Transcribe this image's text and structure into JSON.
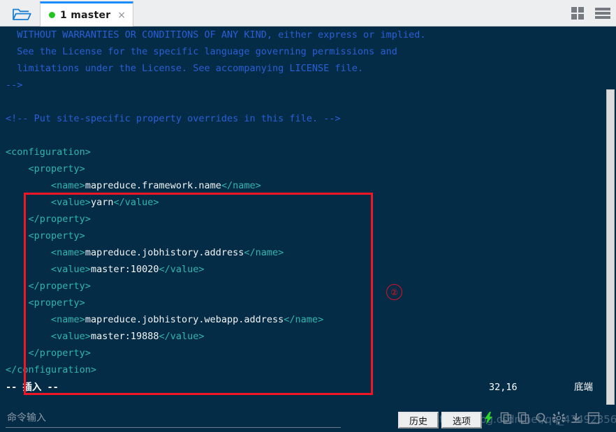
{
  "window": {
    "tab": {
      "label": "1 master",
      "status_dot_color": "#21c521",
      "close_glyph": "×"
    },
    "folder_icon": "folder-open-icon",
    "right_icons": [
      "grid-view-icon",
      "menu-icon"
    ]
  },
  "editor": {
    "lines": [
      {
        "indent": 2,
        "parts": [
          {
            "cls": "cmt",
            "t": "WITHOUT WARRANTIES OR CONDITIONS OF ANY KIND, either express or implied."
          }
        ]
      },
      {
        "indent": 2,
        "parts": [
          {
            "cls": "cmt",
            "t": "See the License for the specific language governing permissions and"
          }
        ]
      },
      {
        "indent": 2,
        "parts": [
          {
            "cls": "cmt",
            "t": "limitations under the License. See accompanying LICENSE file."
          }
        ]
      },
      {
        "indent": 0,
        "parts": [
          {
            "cls": "cmt",
            "t": "-->"
          }
        ]
      },
      {
        "indent": 0,
        "parts": [
          {
            "cls": "cmt",
            "t": ""
          }
        ]
      },
      {
        "indent": 0,
        "parts": [
          {
            "cls": "cmt",
            "t": "<!-- Put site-specific property overrides in this file. -->"
          }
        ]
      },
      {
        "indent": 0,
        "parts": [
          {
            "cls": "cmt",
            "t": ""
          }
        ]
      },
      {
        "indent": 0,
        "parts": [
          {
            "cls": "tag",
            "t": "<configuration>"
          }
        ]
      },
      {
        "indent": 4,
        "parts": [
          {
            "cls": "tag",
            "t": "<property>"
          }
        ]
      },
      {
        "indent": 8,
        "parts": [
          {
            "cls": "tag",
            "t": "<name>"
          },
          {
            "cls": "txt",
            "t": "mapreduce.framework.name"
          },
          {
            "cls": "tag",
            "t": "</name>"
          }
        ]
      },
      {
        "indent": 8,
        "parts": [
          {
            "cls": "tag",
            "t": "<value>"
          },
          {
            "cls": "txt",
            "t": "yarn"
          },
          {
            "cls": "tag",
            "t": "</value>"
          }
        ]
      },
      {
        "indent": 4,
        "parts": [
          {
            "cls": "tag",
            "t": "</property>"
          }
        ]
      },
      {
        "indent": 4,
        "parts": [
          {
            "cls": "tag",
            "t": "<property>"
          }
        ]
      },
      {
        "indent": 8,
        "parts": [
          {
            "cls": "tag",
            "t": "<name>"
          },
          {
            "cls": "txt",
            "t": "mapreduce.jobhistory.address"
          },
          {
            "cls": "tag",
            "t": "</name>"
          }
        ]
      },
      {
        "indent": 8,
        "parts": [
          {
            "cls": "tag",
            "t": "<value>"
          },
          {
            "cls": "txt",
            "t": "master:10020"
          },
          {
            "cls": "tag",
            "t": "</value>"
          }
        ]
      },
      {
        "indent": 4,
        "parts": [
          {
            "cls": "tag",
            "t": "</property>"
          }
        ]
      },
      {
        "indent": 4,
        "parts": [
          {
            "cls": "tag",
            "t": "<property>"
          }
        ]
      },
      {
        "indent": 8,
        "parts": [
          {
            "cls": "tag",
            "t": "<name>"
          },
          {
            "cls": "txt",
            "t": "mapreduce.jobhistory.webapp.address"
          },
          {
            "cls": "tag",
            "t": "</name>"
          }
        ]
      },
      {
        "indent": 8,
        "parts": [
          {
            "cls": "tag",
            "t": "<value>"
          },
          {
            "cls": "txt",
            "t": "master:19888"
          },
          {
            "cls": "tag",
            "t": "</value>"
          }
        ]
      },
      {
        "indent": 4,
        "parts": [
          {
            "cls": "tag",
            "t": "</property>"
          }
        ]
      },
      {
        "indent": 0,
        "parts": [
          {
            "cls": "tag",
            "t": "</configuration>"
          }
        ]
      }
    ]
  },
  "status": {
    "mode": "-- 插入 --",
    "position": "32,16",
    "scroll_state": "底端"
  },
  "annotation": {
    "marker_label": "②",
    "box_color": "#f01626"
  },
  "bottom": {
    "command_input_placeholder": "命令输入",
    "command_input_value": "",
    "history_button": "历史",
    "options_button": "选项",
    "tray_icons": [
      "lightning-icon",
      "copy-icon",
      "paste-icon",
      "search-icon",
      "gear-icon",
      "download-icon",
      "window-icon"
    ],
    "watermark": "https://blog.csdn.net/qq_43492356"
  }
}
